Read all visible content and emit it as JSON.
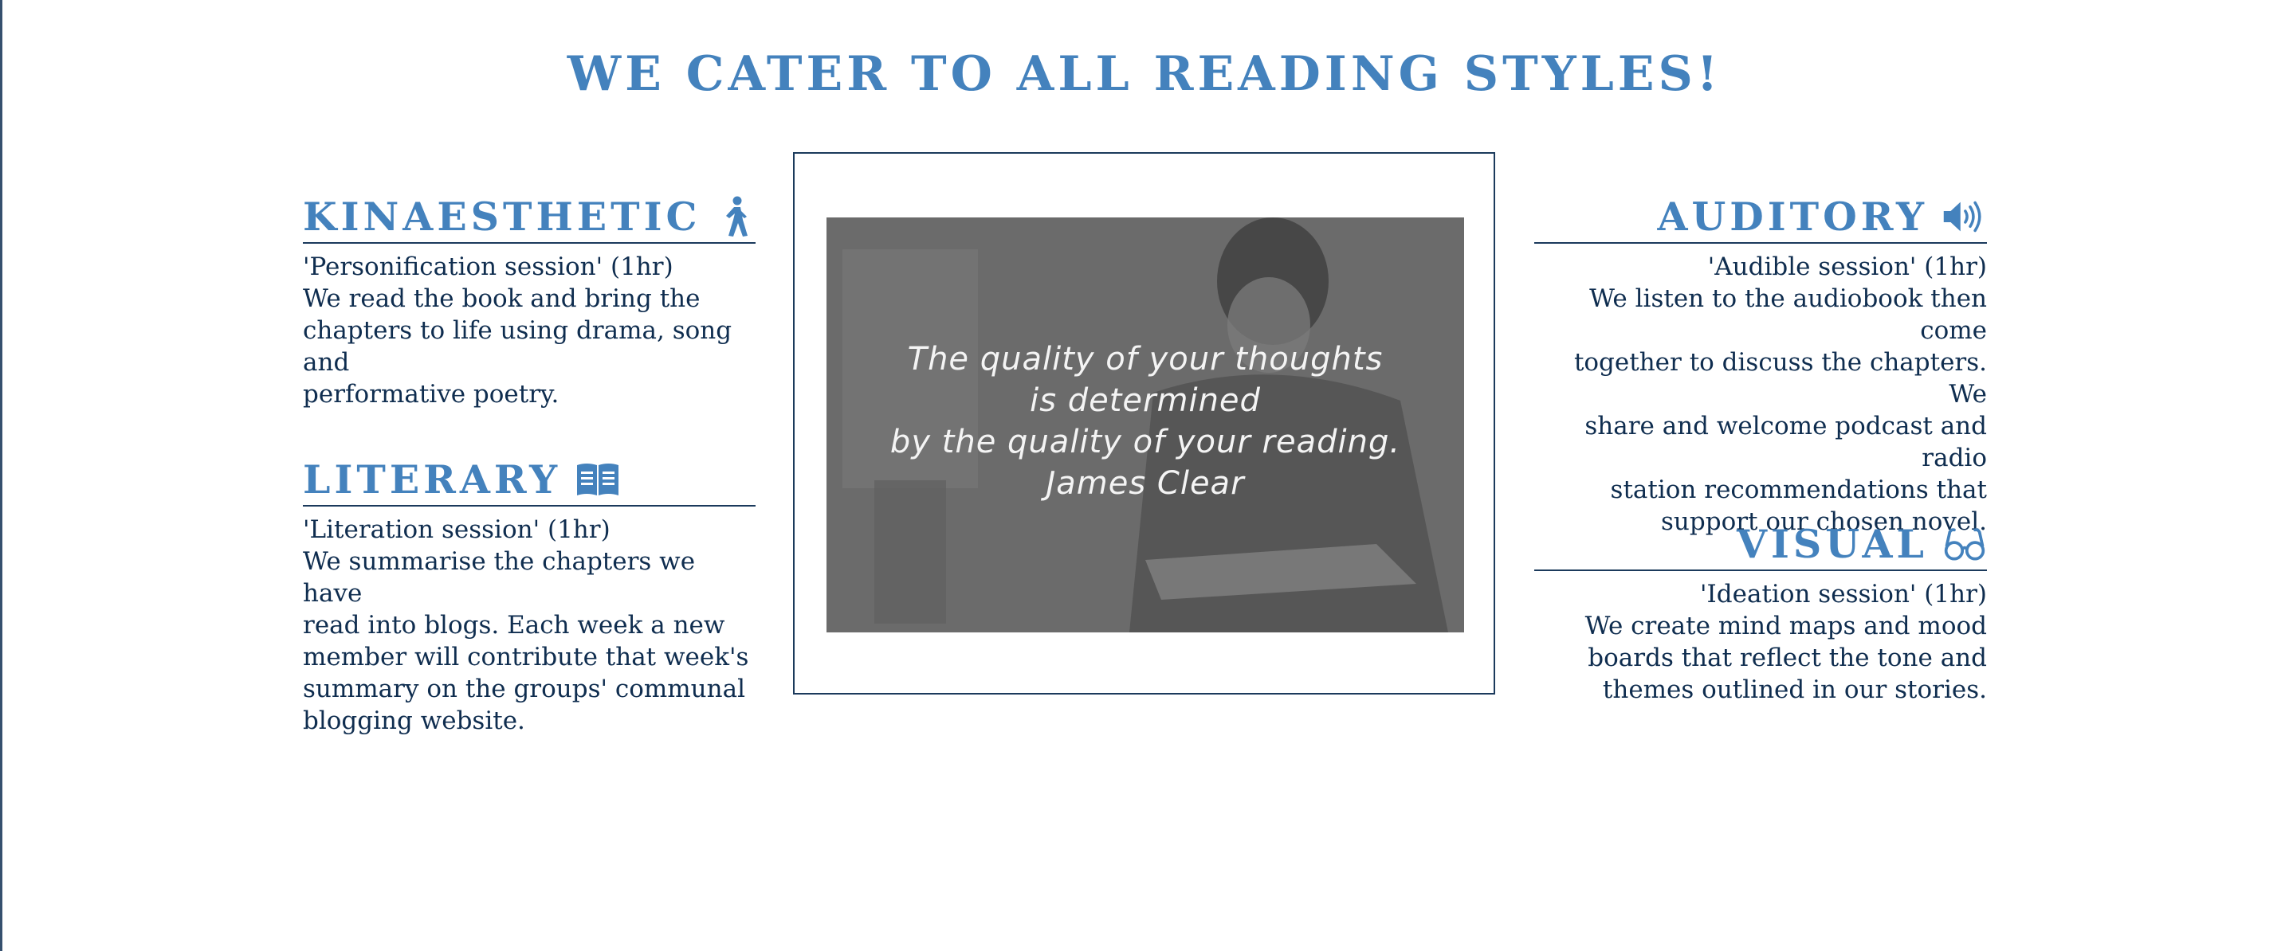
{
  "header": {
    "title": "WE CATER TO ALL READING STYLES!"
  },
  "styles": {
    "kinaesthetic": {
      "title": "KINAESTHETIC",
      "icon": "walking-person-icon",
      "session": "'Personification session' (1hr)",
      "description": [
        "We read the book and bring the",
        "chapters to life using drama, song and",
        "performative poetry."
      ]
    },
    "literary": {
      "title": "LITERARY",
      "icon": "open-book-icon",
      "session": "'Literation session' (1hr)",
      "description": [
        "We summarise the chapters we have",
        "read into blogs. Each week a new",
        "member will contribute that week's",
        "summary on the groups' communal",
        "blogging website."
      ]
    },
    "auditory": {
      "title": "AUDITORY",
      "icon": "speaker-volume-icon",
      "session": "'Audible session' (1hr)",
      "description": [
        "We listen to the audiobook then come",
        "together to discuss the chapters. We",
        "share and welcome podcast and radio",
        "station recommendations that",
        "support our chosen novel."
      ]
    },
    "visual": {
      "title": "VISUAL",
      "icon": "glasses-icon",
      "session": "'Ideation session' (1hr)",
      "description": [
        "We create mind maps and mood",
        "boards that reflect the tone and",
        "themes outlined in our stories."
      ]
    }
  },
  "quote": {
    "lines": [
      "The quality of your thoughts",
      "is determined",
      "by the quality of your reading.",
      "James Clear"
    ]
  },
  "colors": {
    "heading": "#4482bd",
    "body_text": "#0f2d4f",
    "rule": "#1b3a5c"
  }
}
